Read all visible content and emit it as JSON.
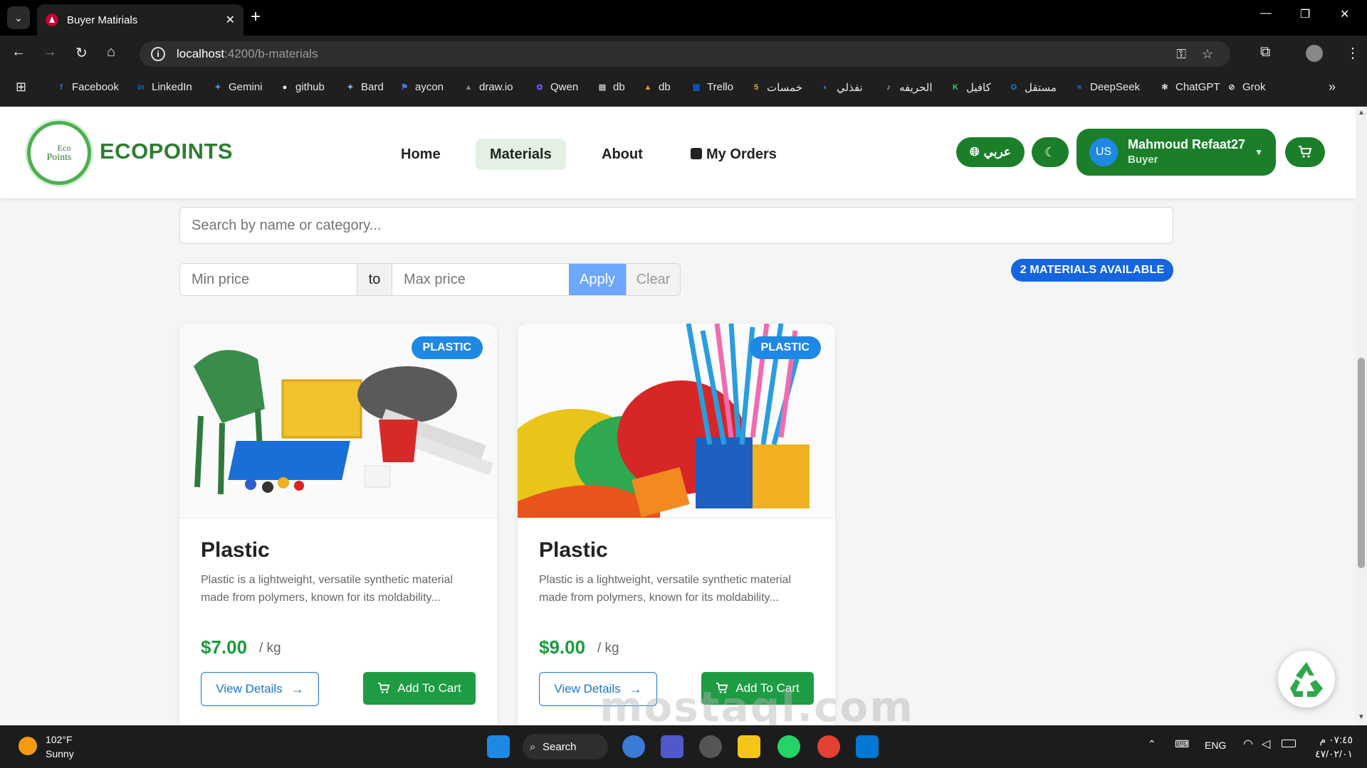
{
  "browser": {
    "tab_title": "Buyer Matirials",
    "url_host": "localhost",
    "url_path": ":4200/b-materials",
    "bookmarks": [
      {
        "label": "Facebook",
        "icon": "facebook-icon",
        "color": "#1877f2",
        "glyph": "f"
      },
      {
        "label": "LinkedIn",
        "icon": "linkedin-icon",
        "color": "#0a66c2",
        "glyph": "in"
      },
      {
        "label": "Gemini",
        "icon": "gemini-icon",
        "color": "#4f8ef7",
        "glyph": "✦"
      },
      {
        "label": "github",
        "icon": "github-icon",
        "color": "#ffffff",
        "glyph": "●"
      },
      {
        "label": "Bard",
        "icon": "bard-icon",
        "color": "#8ab4f8",
        "glyph": "✦"
      },
      {
        "label": "aycon",
        "icon": "flag-icon",
        "color": "#4f7cff",
        "glyph": "⚑"
      },
      {
        "label": "draw.io",
        "icon": "drawio-icon",
        "color": "#888888",
        "glyph": "▲"
      },
      {
        "label": "Qwen",
        "icon": "qwen-icon",
        "color": "#6b5bff",
        "glyph": "✿"
      },
      {
        "label": "db",
        "icon": "db-icon",
        "color": "#cccccc",
        "glyph": "▤"
      },
      {
        "label": "db",
        "icon": "db2-icon",
        "color": "#e0a030",
        "glyph": "▲"
      },
      {
        "label": "Trello",
        "icon": "trello-icon",
        "color": "#0c66e4",
        "glyph": "▥"
      },
      {
        "label": "خمسات",
        "icon": "khamsat-icon",
        "color": "#f5a623",
        "glyph": "5"
      },
      {
        "label": "نفذلي",
        "icon": "nafezly-icon",
        "color": "#2b7bff",
        "glyph": "◐"
      },
      {
        "label": "الحريفه",
        "icon": "harifa-icon",
        "color": "#dddddd",
        "glyph": "♪"
      },
      {
        "label": "كافيل",
        "icon": "kafiil-icon",
        "color": "#2ecc71",
        "glyph": "K"
      },
      {
        "label": "مستقل",
        "icon": "mostaql-icon",
        "color": "#1e88e5",
        "glyph": "G"
      },
      {
        "label": "DeepSeek",
        "icon": "deepseek-icon",
        "color": "#4d6bfe",
        "glyph": "≈"
      },
      {
        "label": "ChatGPT",
        "icon": "chatgpt-icon",
        "color": "#dddddd",
        "glyph": "✻"
      },
      {
        "label": "Grok",
        "icon": "grok-icon",
        "color": "#dddddd",
        "glyph": "⊘"
      }
    ]
  },
  "header": {
    "logo_top": "Eco",
    "logo_bottom": "Points",
    "brand": "ECOPOINTS",
    "nav": [
      {
        "label": "Home",
        "active": false
      },
      {
        "label": "Materials",
        "active": true
      },
      {
        "label": "About",
        "active": false
      },
      {
        "label": "My Orders",
        "active": false
      }
    ],
    "language_label": "عربي",
    "user": {
      "initials": "US",
      "name": "Mahmoud Refaat27",
      "role": "Buyer"
    }
  },
  "filters": {
    "search_placeholder": "Search by name or category...",
    "min_placeholder": "Min price",
    "to_label": "to",
    "max_placeholder": "Max price",
    "apply_label": "Apply",
    "clear_label": "Clear",
    "count_label": "2 MATERIALS AVAILABLE"
  },
  "materials": [
    {
      "category": "PLASTIC",
      "title": "Plastic",
      "description": "Plastic is a lightweight, versatile synthetic material made from polymers, known for its moldability...",
      "price": "$7.00",
      "unit": "/ kg",
      "view_label": "View Details",
      "cart_label": "Add To Cart"
    },
    {
      "category": "PLASTIC",
      "title": "Plastic",
      "description": "Plastic is a lightweight, versatile synthetic material made from polymers, known for its moldability...",
      "price": "$9.00",
      "unit": "/ kg",
      "view_label": "View Details",
      "cart_label": "Add To Cart"
    }
  ],
  "taskbar": {
    "weather_temp": "102°F",
    "weather_text": "Sunny",
    "search_label": "Search",
    "language": "ENG",
    "time": "٠٧:٤٥ م",
    "date": "٤٧/٠٢/٠١"
  },
  "watermark": "mostaql.com",
  "colors": {
    "accent_green": "#1b7f2a",
    "brand_green": "#2e7d32",
    "badge_blue": "#1565e0",
    "price_green": "#1a9c3a"
  }
}
